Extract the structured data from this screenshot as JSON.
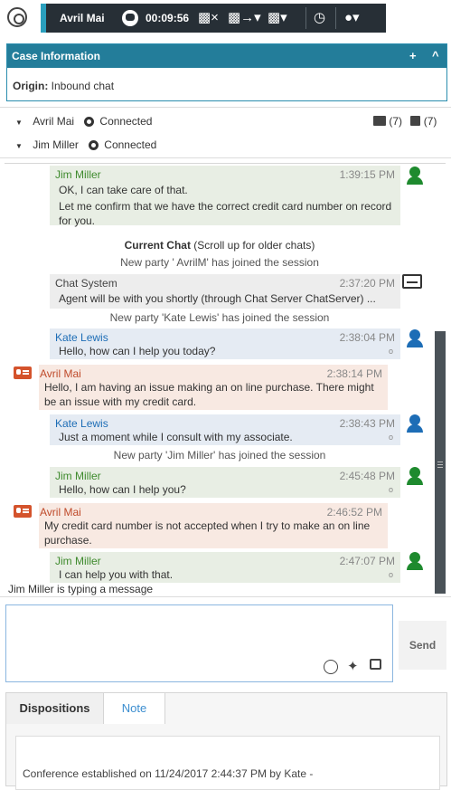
{
  "toolbar": {
    "agent_name": "Avril Mai",
    "timer": "00:09:56"
  },
  "case_info": {
    "title": "Case Information",
    "add_label": "+",
    "collapse_label": "^",
    "origin_label": "Origin:",
    "origin_value": "Inbound chat"
  },
  "parties": [
    {
      "name": "Avril Mai",
      "status": "Connected"
    },
    {
      "name": "Jim Miller",
      "status": "Connected"
    }
  ],
  "counters": {
    "first": "(7)",
    "second": "(7)"
  },
  "transcript": {
    "m1": {
      "who": "Jim Miller",
      "time": "1:39:15 PM",
      "lines": [
        "OK, I can take care of that.",
        "Let me confirm that we have the correct credit card number on record for you."
      ]
    },
    "current_chat_bold": "Current Chat",
    "current_chat_rest": " (Scroll up for older chats)",
    "sys1": "New party ' AvrilM' has joined the session",
    "m2": {
      "who": "Chat System",
      "time": "2:37:20 PM",
      "text": "Agent will be with you shortly (through Chat Server ChatServer) ..."
    },
    "sys2": "New party 'Kate Lewis' has joined the session",
    "m3": {
      "who": "Kate Lewis",
      "time": "2:38:04 PM",
      "text": "Hello, how can I help you today?"
    },
    "m4": {
      "who": "Avril Mai",
      "time": "2:38:14 PM",
      "text": "Hello, I am having an issue making an on line purchase. There might be an issue with my credit card."
    },
    "m5": {
      "who": "Kate Lewis",
      "time": "2:38:43 PM",
      "text": "Just a moment while I consult with my associate."
    },
    "sys3": "New party 'Jim Miller' has joined the session",
    "m6": {
      "who": "Jim Miller",
      "time": "2:45:48 PM",
      "text": "Hello, how can I help you?"
    },
    "m7": {
      "who": "Avril Mai",
      "time": "2:46:52 PM",
      "text": "My credit card number is not accepted when I try to make an on line purchase."
    },
    "m8": {
      "who": "Jim Miller",
      "time": "2:47:07 PM",
      "text": "I can help you with that."
    },
    "read_marker": "o"
  },
  "typing_indicator": "Jim Miller is typing a message",
  "composer": {
    "send_label": "Send"
  },
  "bottom": {
    "tabs": [
      "Dispositions",
      "Note"
    ],
    "note_text": "Conference established on 11/24/2017 2:44:37 PM by Kate -"
  },
  "colors": {
    "header": "#237d9a",
    "toolbar": "#272f36",
    "agent_green": "#1e8a2e",
    "agent_blue": "#1d6db6",
    "customer_orange": "#d4532c"
  }
}
